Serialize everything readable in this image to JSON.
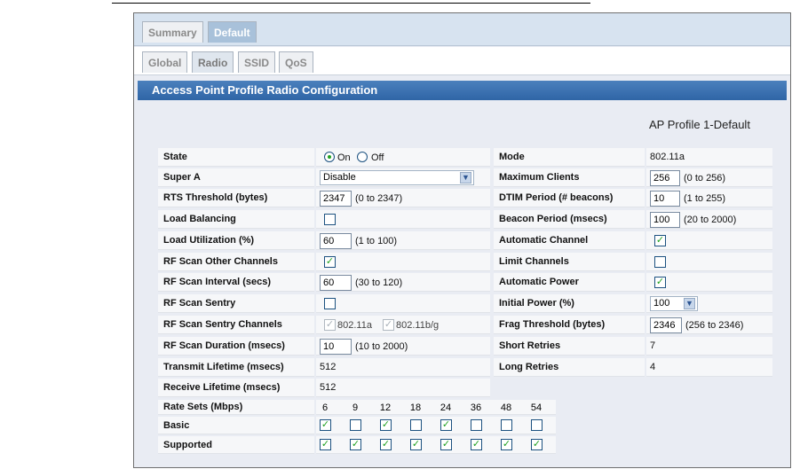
{
  "tabs_top": [
    {
      "label": "Summary"
    },
    {
      "label": "Default"
    }
  ],
  "tabs_sub": [
    {
      "label": "Global"
    },
    {
      "label": "Radio"
    },
    {
      "label": "SSID"
    },
    {
      "label": "QoS"
    }
  ],
  "header": {
    "title": "Access Point Profile Radio Configuration"
  },
  "profile_name": "AP Profile 1-Default",
  "left": {
    "state": {
      "label": "State",
      "on": "On",
      "off": "Off"
    },
    "super_a": {
      "label": "Super A",
      "value": "Disable"
    },
    "rts": {
      "label": "RTS Threshold (bytes)",
      "value": "2347",
      "range": "(0 to 2347)"
    },
    "load_balancing": {
      "label": "Load Balancing"
    },
    "load_util": {
      "label": "Load Utilization (%)",
      "value": "60",
      "range": "(1 to 100)"
    },
    "rf_scan_other": {
      "label": "RF Scan Other Channels"
    },
    "rf_scan_interval": {
      "label": "RF Scan Interval (secs)",
      "value": "60",
      "range": "(30 to 120)"
    },
    "rf_scan_sentry": {
      "label": "RF Scan Sentry"
    },
    "rf_scan_sentry_channels": {
      "label": "RF Scan Sentry Channels",
      "a": "802.11a",
      "bg": "802.11b/g"
    },
    "rf_scan_duration": {
      "label": "RF Scan Duration (msecs)",
      "value": "10",
      "range": "(10 to 2000)"
    },
    "transmit_lifetime": {
      "label": "Transmit Lifetime (msecs)",
      "value": "512"
    },
    "receive_lifetime": {
      "label": "Receive Lifetime (msecs)",
      "value": "512"
    },
    "rate_sets": {
      "label": "Rate Sets (Mbps)"
    },
    "basic": {
      "label": "Basic"
    },
    "supported": {
      "label": "Supported"
    }
  },
  "right": {
    "mode": {
      "label": "Mode",
      "value": "802.11a"
    },
    "max_clients": {
      "label": "Maximum Clients",
      "value": "256",
      "range": "(0 to 256)"
    },
    "dtim": {
      "label": "DTIM Period (# beacons)",
      "value": "10",
      "range": "(1 to 255)"
    },
    "beacon": {
      "label": "Beacon Period (msecs)",
      "value": "100",
      "range": "(20 to 2000)"
    },
    "auto_channel": {
      "label": "Automatic Channel"
    },
    "limit_channels": {
      "label": "Limit Channels"
    },
    "auto_power": {
      "label": "Automatic Power"
    },
    "initial_power": {
      "label": "Initial Power (%)",
      "value": "100"
    },
    "frag": {
      "label": "Frag Threshold (bytes)",
      "value": "2346",
      "range": "(256 to 2346)"
    },
    "short_retries": {
      "label": "Short Retries",
      "value": "7"
    },
    "long_retries": {
      "label": "Long Retries",
      "value": "4"
    }
  },
  "rates": [
    "6",
    "9",
    "12",
    "18",
    "24",
    "36",
    "48",
    "54"
  ],
  "basic_checked": [
    true,
    false,
    true,
    false,
    true,
    false,
    false,
    false
  ],
  "supported_checked": [
    true,
    true,
    true,
    true,
    true,
    true,
    true,
    true
  ],
  "checkbox_states": {
    "load_balancing": false,
    "rf_scan_other": true,
    "rf_scan_sentry": false,
    "sentry_a": true,
    "sentry_bg": true,
    "auto_channel": true,
    "limit_channels": false,
    "auto_power": true
  },
  "check_mark": "✓",
  "select_arrow": "▼",
  "colors": {
    "header": "#3a6fb0",
    "check": "#21a121"
  }
}
